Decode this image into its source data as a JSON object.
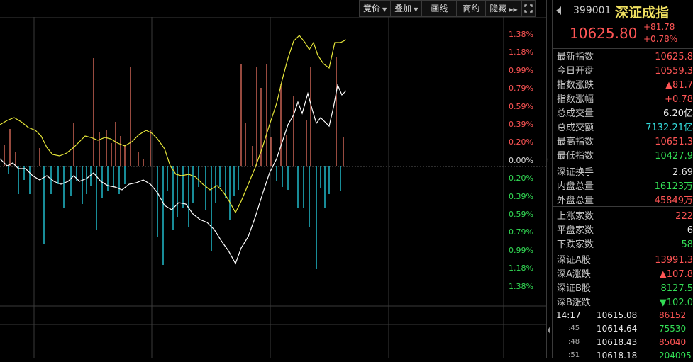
{
  "toolbar": {
    "bid_label": "竞价",
    "overlay_label": "叠加",
    "draw_label": "画线",
    "vote_label": "商约",
    "hide_label": "隐藏"
  },
  "axis": {
    "pct_labels": [
      {
        "text": "1.38%",
        "color": "#ff5555"
      },
      {
        "text": "1.18%",
        "color": "#ff5555"
      },
      {
        "text": "0.99%",
        "color": "#ff5555"
      },
      {
        "text": "0.79%",
        "color": "#ff5555"
      },
      {
        "text": "0.59%",
        "color": "#ff5555"
      },
      {
        "text": "0.39%",
        "color": "#ff5555"
      },
      {
        "text": "0.20%",
        "color": "#ff5555"
      },
      {
        "text": "0.00%",
        "color": "#dddddd"
      },
      {
        "text": "0.20%",
        "color": "#33dd55"
      },
      {
        "text": "0.39%",
        "color": "#33dd55"
      },
      {
        "text": "0.59%",
        "color": "#33dd55"
      },
      {
        "text": "0.79%",
        "color": "#33dd55"
      },
      {
        "text": "0.99%",
        "color": "#33dd55"
      },
      {
        "text": "1.18%",
        "color": "#33dd55"
      },
      {
        "text": "1.38%",
        "color": "#33dd55"
      }
    ]
  },
  "header": {
    "code": "399001",
    "name": "深证成指",
    "price": "10625.80",
    "change": "+81.78",
    "change_pct": "+0.78%"
  },
  "stats": [
    {
      "label": "最新指数",
      "value": "10625.8",
      "color": "#ff5555"
    },
    {
      "label": "今日开盘",
      "value": "10559.3",
      "color": "#ff5555"
    },
    {
      "label": "指数涨跌",
      "value": "▲81.7",
      "color": "#ff5555"
    },
    {
      "label": "指数涨幅",
      "value": "+0.78",
      "color": "#ff5555"
    },
    {
      "label": "总成交量",
      "value": "6.20亿",
      "color": "#e8e8e8"
    },
    {
      "label": "总成交额",
      "value": "7132.21亿",
      "color": "#33dddd"
    },
    {
      "label": "最高指数",
      "value": "10651.3",
      "color": "#ff5555"
    },
    {
      "label": "最低指数",
      "value": "10427.9",
      "color": "#33dd55"
    },
    {
      "label": "深证换手",
      "value": "2.69",
      "color": "#e8e8e8"
    },
    {
      "label": "内盘总量",
      "value": "16123万",
      "color": "#33dd55"
    },
    {
      "label": "外盘总量",
      "value": "45849万",
      "color": "#ff5555"
    },
    {
      "label": "上涨家数",
      "value": "222",
      "color": "#ff5555"
    },
    {
      "label": "平盘家数",
      "value": "6",
      "color": "#e8e8e8"
    },
    {
      "label": "下跌家数",
      "value": "58",
      "color": "#33dd55"
    },
    {
      "label": "深证A股",
      "value": "13991.3",
      "color": "#ff5555"
    },
    {
      "label": "深A涨跌",
      "value": "▲107.8",
      "color": "#ff5555"
    },
    {
      "label": "深证B股",
      "value": "8127.5",
      "color": "#33dd55"
    },
    {
      "label": "深B涨跌",
      "value": "▼102.0",
      "color": "#33dd55"
    }
  ],
  "ticks": [
    {
      "time": "14:17",
      "price": "10615.08",
      "vol": "86152",
      "vol_color": "#ff5555"
    },
    {
      "time": ":45",
      "price": "10614.64",
      "vol": "75530",
      "vol_color": "#33dd55"
    },
    {
      "time": ":48",
      "price": "10618.43",
      "vol": "85040",
      "vol_color": "#ff5555"
    },
    {
      "time": ":51",
      "price": "10618.18",
      "vol": "204095",
      "vol_color": "#33dd55"
    }
  ],
  "colors": {
    "up": "#ff5555",
    "down": "#33dd55",
    "bar_up": "#d86a5a",
    "bar_down": "#22c9d9",
    "white_line": "#ffffff",
    "yellow_line": "#e8e83a",
    "price_yellow": "#f0e060"
  }
}
